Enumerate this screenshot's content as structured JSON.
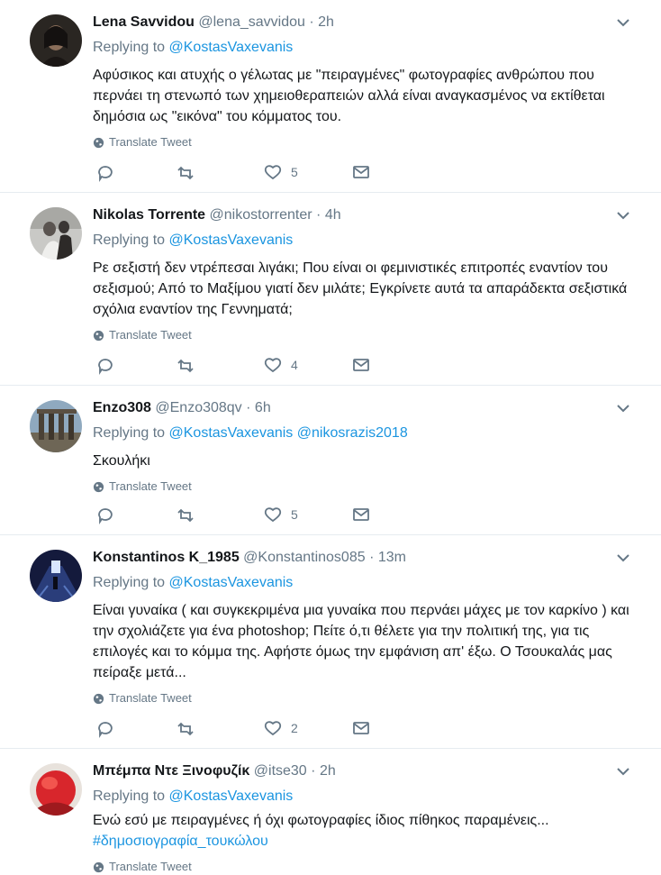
{
  "tweets": [
    {
      "name": "Lena Savvidou",
      "handle": "@lena_savvidou",
      "time": "2h",
      "replying_prefix": "Replying to",
      "replying_to": [
        "@KostasVaxevanis"
      ],
      "text": "Αφύσικος και ατυχής ο γέλωτας με \"πειραγμένες\" φωτογραφίες ανθρώπου που περνάει τη στενωπό των χημειοθεραπειών αλλά είναι αναγκασμένος να εκτίθεται δημόσια ως \"εικόνα\" του κόμματος του.",
      "hashtag": "",
      "translate": "Translate Tweet",
      "likes": "5"
    },
    {
      "name": "Nikolas Torrente",
      "handle": "@nikostorrenter",
      "time": "4h",
      "replying_prefix": "Replying to",
      "replying_to": [
        "@KostasVaxevanis"
      ],
      "text": "Ρε σεξιστή δεν ντρέπεσαι λιγάκι; Που είναι οι φεμινιστικές επιτροπές εναντίον του σεξισμού; Από το Μαξίμου γιατί δεν μιλάτε; Εγκρίνετε αυτά τα απαράδεκτα σεξιστικά σχόλια εναντίον της Γεννηματά;",
      "hashtag": "",
      "translate": "Translate Tweet",
      "likes": "4"
    },
    {
      "name": "Enzo308",
      "handle": "@Enzo308qv",
      "time": "6h",
      "replying_prefix": "Replying to",
      "replying_to": [
        "@KostasVaxevanis",
        "@nikosrazis2018"
      ],
      "text": "Σκουλήκι",
      "hashtag": "",
      "translate": "Translate Tweet",
      "likes": "5"
    },
    {
      "name": "Konstantinos K_1985",
      "handle": "@Konstantinos085",
      "time": "13m",
      "replying_prefix": "Replying to",
      "replying_to": [
        "@KostasVaxevanis"
      ],
      "text": "Είναι γυναίκα ( και συγκεκριμένα μια γυναίκα που περνάει μάχες με τον καρκίνο ) και την σχολιάζετε για ένα photoshop; Πείτε ό,τι θέλετε για την πολιτική της, για τις επιλογές και το κόμμα της. Αφήστε όμως την εμφάνιση απ' έξω. Ο Τσουκαλάς μας πείραξε μετά...",
      "hashtag": "",
      "translate": "Translate Tweet",
      "likes": "2"
    },
    {
      "name": "Μπέμπα Ντε Ξινοφυζίκ",
      "handle": "@itse30",
      "time": "2h",
      "replying_prefix": "Replying to",
      "replying_to": [
        "@KostasVaxevanis"
      ],
      "text": "Ενώ εσύ με πειραγμένες ή όχι φωτογραφίες ίδιος πίθηκος παραμένεις...",
      "hashtag": "#δημοσιογραφία_τουκώλου",
      "translate": "Translate Tweet",
      "likes": ""
    }
  ],
  "colors": {
    "link": "#1b95e0",
    "muted": "#657786",
    "divider": "#e6ecf0",
    "text": "#14171a"
  },
  "icons": [
    "chevron-down-icon",
    "globe-icon",
    "reply-icon",
    "retweet-icon",
    "like-icon",
    "message-icon"
  ]
}
